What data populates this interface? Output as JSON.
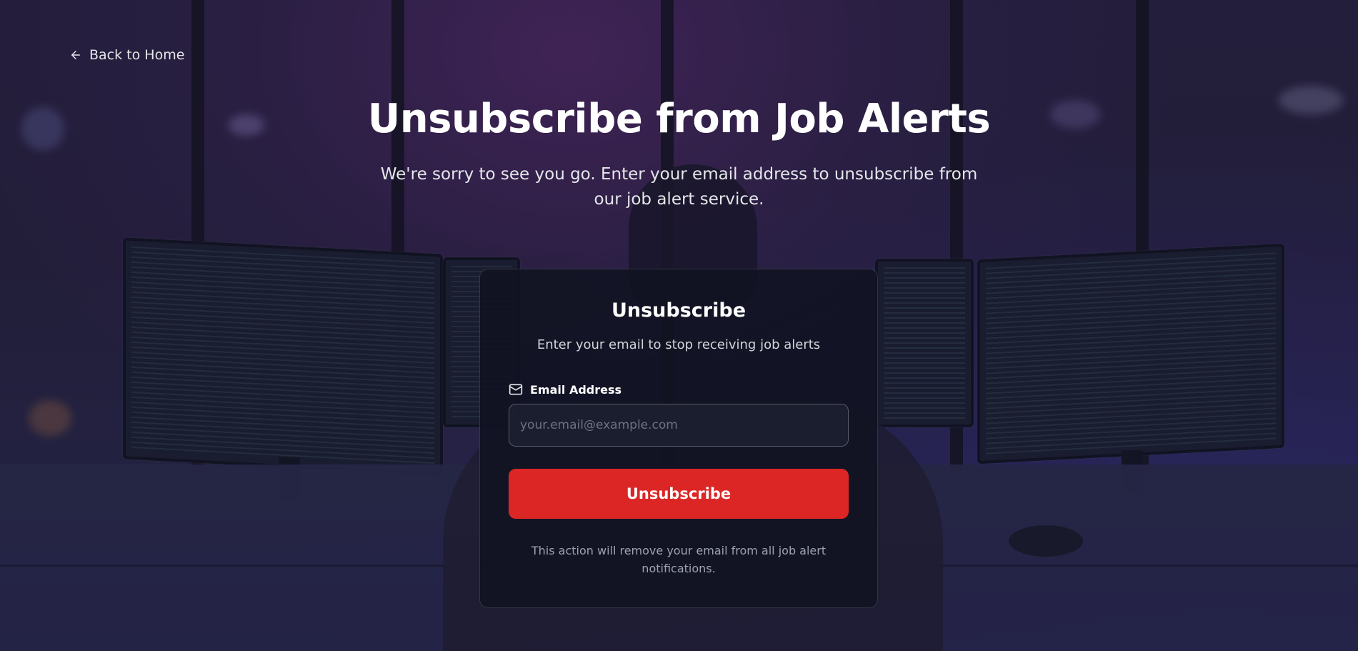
{
  "nav": {
    "back_label": "Back to Home",
    "back_icon": "arrow-left-icon"
  },
  "hero": {
    "title": "Unsubscribe from Job Alerts",
    "subtitle": "We're sorry to see you go. Enter your email address to unsubscribe from our job alert service."
  },
  "card": {
    "title": "Unsubscribe",
    "subtitle": "Enter your email to stop receiving job alerts",
    "email_label": "Email Address",
    "email_icon": "mail-icon",
    "email_value": "",
    "email_placeholder": "your.email@example.com",
    "submit_label": "Unsubscribe",
    "footnote": "This action will remove your email from all job alert notifications."
  },
  "colors": {
    "accent": "#dc2626",
    "card_background": "#111321",
    "text_primary": "#ffffff",
    "text_muted": "#9ca3af"
  }
}
